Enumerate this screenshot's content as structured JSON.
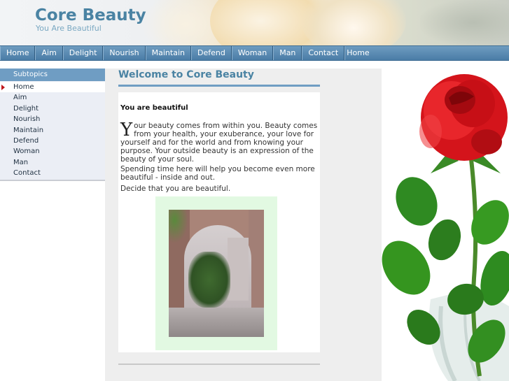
{
  "site": {
    "title": "Core Beauty",
    "tagline": "You Are Beautiful"
  },
  "nav": [
    {
      "label": "Home"
    },
    {
      "label": "Aim"
    },
    {
      "label": "Delight"
    },
    {
      "label": "Nourish"
    },
    {
      "label": "Maintain"
    },
    {
      "label": "Defend"
    },
    {
      "label": "Woman"
    },
    {
      "label": "Man"
    },
    {
      "label": "Contact"
    },
    {
      "label": "Home"
    }
  ],
  "sidebar": {
    "header": "Subtopics",
    "items": [
      {
        "label": "Home"
      },
      {
        "label": "Aim"
      },
      {
        "label": "Delight"
      },
      {
        "label": "Nourish"
      },
      {
        "label": "Maintain"
      },
      {
        "label": "Defend"
      },
      {
        "label": "Woman"
      },
      {
        "label": "Man"
      },
      {
        "label": "Contact"
      }
    ],
    "active_index": 0
  },
  "main": {
    "page_title": "Welcome to Core Beauty",
    "intro": "You are beautiful",
    "dropcap": "Y",
    "para1_rest": "our beauty comes from within you.  Beauty comes from your health, your exuberance, your love for yourself and for the world and from knowing your purpose.  Your outside beauty is an expression of the beauty of your soul.",
    "para2": "Spending time here will help you become even more beautiful - inside and out.",
    "para3": "Decide that you are beautiful."
  },
  "colors": {
    "brand": "#4a83a3",
    "nav_bg": "#5b8bb3",
    "sidebar_bg": "#ebeef5",
    "active_marker": "#c0161b",
    "photo_frame": "#e2f9e2"
  }
}
